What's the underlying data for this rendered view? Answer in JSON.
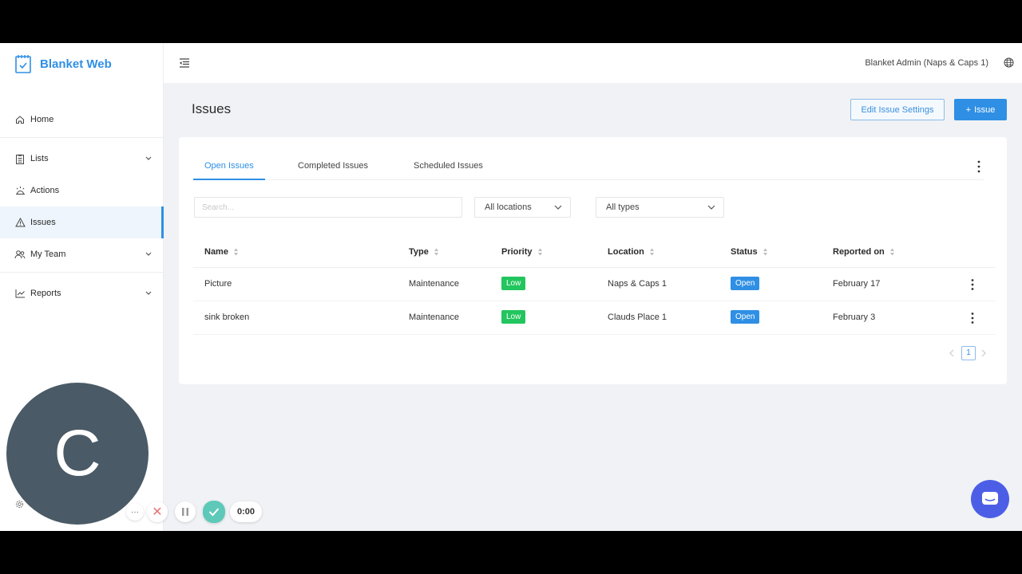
{
  "app": {
    "name": "Blanket Web"
  },
  "topbar": {
    "account": "Blanket Admin (Naps & Caps 1)"
  },
  "sidebar": {
    "items": [
      {
        "label": "Home",
        "icon": "home-icon"
      },
      {
        "label": "Lists",
        "icon": "clipboard-icon"
      },
      {
        "label": "Actions",
        "icon": "actions-icon"
      },
      {
        "label": "Issues",
        "icon": "warning-icon"
      },
      {
        "label": "My Team",
        "icon": "team-icon"
      },
      {
        "label": "Reports",
        "icon": "chart-line-icon"
      }
    ]
  },
  "page": {
    "title": "Issues",
    "edit_settings_label": "Edit Issue Settings",
    "add_issue_label": "Issue"
  },
  "tabs": [
    "Open Issues",
    "Completed Issues",
    "Scheduled Issues"
  ],
  "filters": {
    "search_placeholder": "Search...",
    "location": "All locations",
    "type": "All types"
  },
  "table": {
    "columns": [
      "Name",
      "Type",
      "Priority",
      "Location",
      "Status",
      "Reported on"
    ],
    "rows": [
      {
        "name": "Picture",
        "type": "Maintenance",
        "priority": "Low",
        "location": "Naps & Caps 1",
        "status": "Open",
        "reported": "February 17"
      },
      {
        "name": "sink broken",
        "type": "Maintenance",
        "priority": "Low",
        "location": "Clauds Place 1",
        "status": "Open",
        "reported": "February 3"
      }
    ]
  },
  "pagination": {
    "current": "1"
  },
  "recorder": {
    "avatar_letter": "C",
    "more": "···",
    "time": "0:00"
  },
  "colors": {
    "accent": "#2f8fe4",
    "low": "#22c55e",
    "open": "#2f8fe4",
    "chat": "#4d5ee6"
  }
}
